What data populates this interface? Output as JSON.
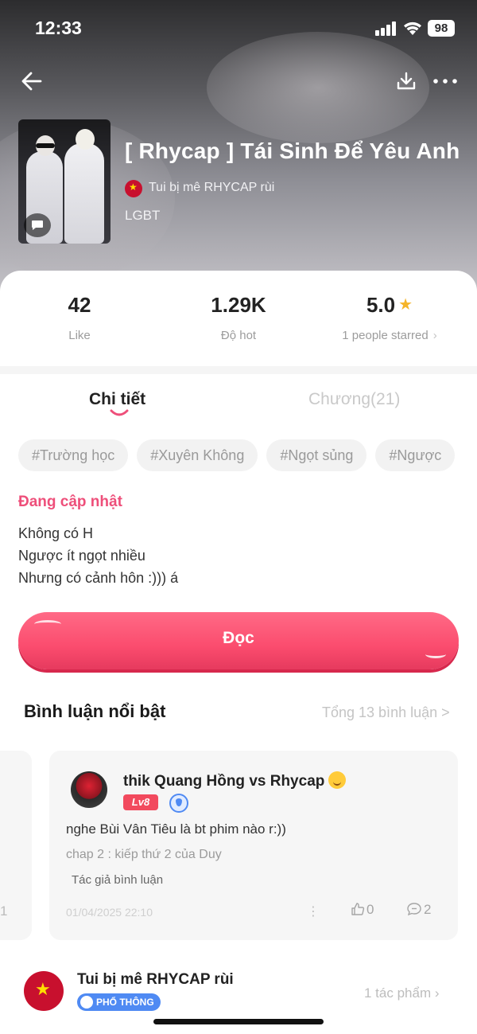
{
  "status_bar": {
    "time": "12:33",
    "battery": "98"
  },
  "book": {
    "title": "[ Rhycap ] Tái Sinh Để Yêu Anh",
    "author": "Tui bị mê RHYCAP rùi",
    "genre": "LGBT"
  },
  "stats": {
    "like_value": "42",
    "like_label": "Like",
    "hot_value": "1.29K",
    "hot_label": "Độ hot",
    "rating_value": "5.0",
    "rating_label": "1 people starred"
  },
  "tabs": {
    "detail": "Chi tiết",
    "chapters": "Chương(21)"
  },
  "tags": [
    "#Trường học",
    "#Xuyên Không",
    "#Ngọt sủng",
    "#Ngược"
  ],
  "update_status": "Đang cập nhật",
  "description": [
    "Không có H",
    "Ngược ít ngọt nhiều",
    "Nhưng có cảnh hôn :))) á"
  ],
  "read_button": "Đọc",
  "comments": {
    "title": "Bình luận nổi bật",
    "total": "Tổng 13 bình luận >",
    "prev_card_count": "1",
    "featured": {
      "user": "thik Quang Hồng vs Rhycap",
      "level": "Lv8",
      "text": "nghe Bùi Vân Tiêu là bt phim nào r:))",
      "quote": "chap 2 : kiếp thứ 2 của Duy",
      "author_note": "Tác giả bình luận",
      "date": "01/04/2025 22:10",
      "likes": "0",
      "replies": "2"
    }
  },
  "author_section": {
    "name": "Tui bị mê RHYCAP rùi",
    "badge": "PHỔ THÔNG",
    "works": "1 tác phẩm"
  },
  "colors": {
    "accent": "#fb4c6e",
    "update_pink": "#ee4f7a",
    "star": "#f5b428",
    "badge_blue": "#4f8af3"
  }
}
